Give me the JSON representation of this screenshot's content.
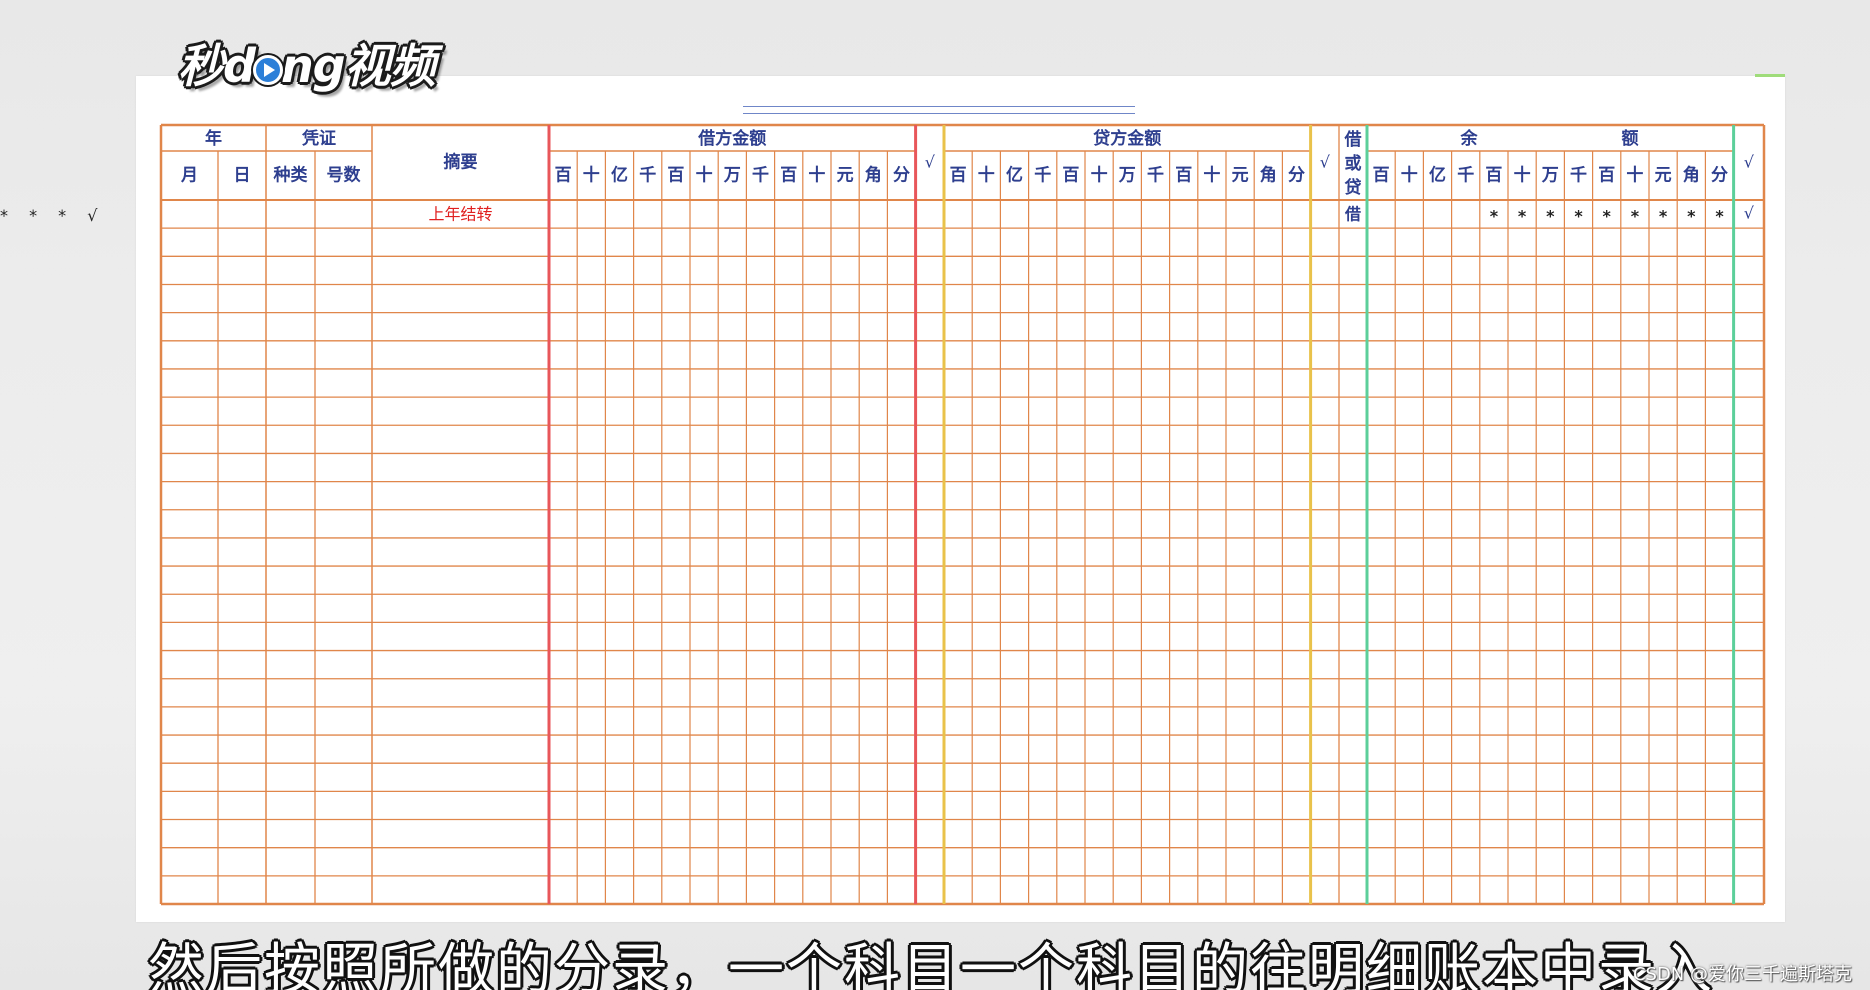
{
  "logo": {
    "part1": "秒d",
    "part2": "ng视频"
  },
  "side_marks": "* * * √",
  "ledger": {
    "header": {
      "year": "年",
      "voucher": "凭证",
      "month": "月",
      "day": "日",
      "voucher_type": "种类",
      "voucher_number": "号数",
      "summary": "摘要",
      "debit_amount": "借方金额",
      "credit_amount": "贷方金额",
      "direction": [
        "借",
        "或",
        "贷"
      ],
      "balance_left": "余",
      "balance_right": "额",
      "check": "√"
    },
    "digit_units": [
      "百",
      "十",
      "亿",
      "千",
      "百",
      "十",
      "万",
      "千",
      "百",
      "十",
      "元",
      "角",
      "分"
    ],
    "first_row": {
      "summary": "上年结转",
      "direction": "借",
      "balance_marks": [
        "",
        "",
        "",
        "",
        "*",
        "*",
        "*",
        "*",
        "*",
        "*",
        "*",
        "*",
        "*"
      ],
      "check": "√"
    },
    "colors": {
      "grid": "#e0864a",
      "debit_divider": "#e8565a",
      "credit_divider": "#e9c24a",
      "balance_divider": "#5ccf9a",
      "header_text": "#2e3f8f",
      "red_text": "#e02020"
    },
    "empty_rows": 24
  },
  "subtitle": "然后按照所做的分录，一个科目一个科目的往明细账本中录入",
  "watermark": "CSDN @爱你三千遍斯塔克"
}
